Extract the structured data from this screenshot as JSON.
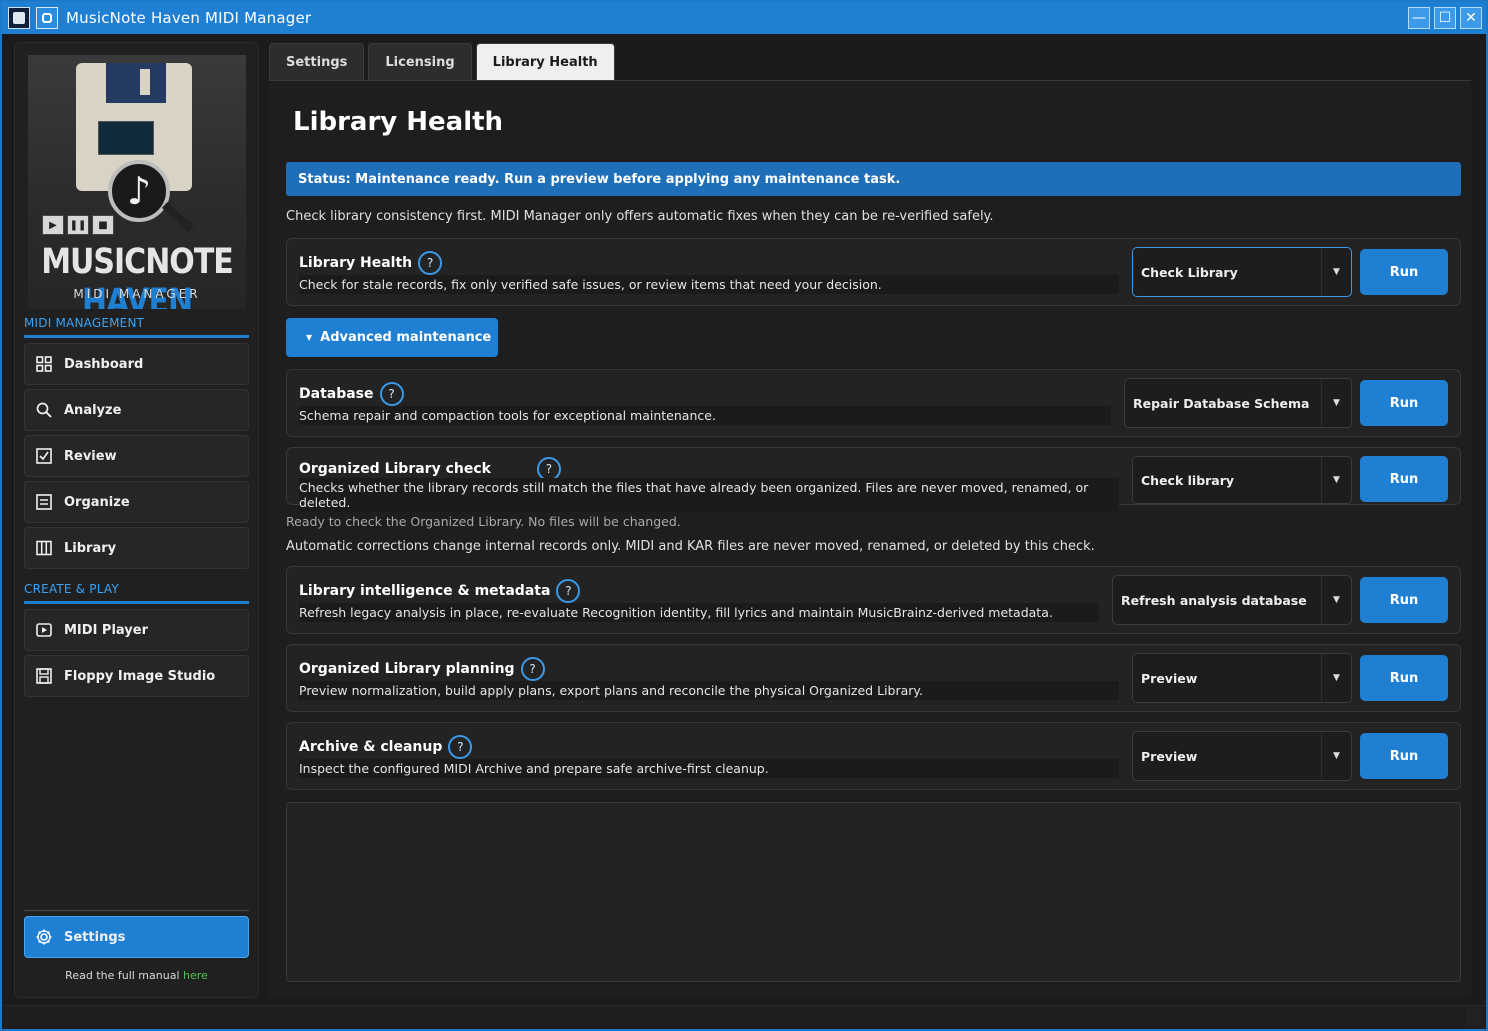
{
  "window": {
    "title": "MusicNote Haven MIDI Manager",
    "minimize_glyph": "—",
    "maximize_glyph": "☐",
    "close_glyph": "✕"
  },
  "logo": {
    "brand_part1": "MUSICNOTE ",
    "brand_part2": "HAVEN",
    "subtitle": "MIDI MANAGER",
    "note_glyph": "♪"
  },
  "sidebar": {
    "section1": "MIDI MANAGEMENT",
    "section2": "CREATE & PLAY",
    "items": [
      {
        "label": "Dashboard",
        "icon": "dashboard-icon"
      },
      {
        "label": "Analyze",
        "icon": "search-icon"
      },
      {
        "label": "Review",
        "icon": "checkbox-icon"
      },
      {
        "label": "Organize",
        "icon": "list-icon"
      },
      {
        "label": "Library",
        "icon": "columns-icon"
      }
    ],
    "create_items": [
      {
        "label": "MIDI Player",
        "icon": "play-icon"
      },
      {
        "label": "Floppy Image Studio",
        "icon": "floppy-icon"
      }
    ],
    "settings_label": "Settings",
    "manual_text": "Read the full manual ",
    "manual_link": "here"
  },
  "tabs": [
    {
      "label": "Settings"
    },
    {
      "label": "Licensing"
    },
    {
      "label": "Library Health"
    }
  ],
  "main": {
    "title": "Library Health",
    "status": "Status: Maintenance ready. Run a preview before applying any maintenance task.",
    "intro": "Check library consistency first. MIDI Manager only offers automatic fixes when they can be re-verified safely.",
    "advanced_label": "Advanced maintenance",
    "organized_note": "Ready to check the Organized Library. No files will be changed.",
    "auto_note": "Automatic corrections change internal records only. MIDI and KAR files are never moved, renamed, or deleted by this check.",
    "run_label": "Run",
    "help_glyph": "?",
    "cards": [
      {
        "title": "Library Health",
        "desc": "Check for stale records, fix only verified safe issues, or review items that need your decision.",
        "combo": "Check Library"
      },
      {
        "title": "Database",
        "desc": "Schema repair and compaction tools for exceptional maintenance.",
        "combo": "Repair Database Schema"
      },
      {
        "title": "Organized Library check",
        "desc": "Checks whether the library records still match the files that have already been organized. Files are never moved, renamed, or deleted.",
        "combo": "Check library"
      },
      {
        "title": "Library intelligence & metadata",
        "desc": "Refresh legacy analysis in place, re-evaluate Recognition identity, fill lyrics and maintain MusicBrainz-derived metadata.",
        "combo": "Refresh analysis database"
      },
      {
        "title": "Organized Library planning",
        "desc": "Preview normalization, build apply plans, export plans and reconcile the physical Organized Library.",
        "combo": "Preview"
      },
      {
        "title": "Archive & cleanup",
        "desc": "Inspect the configured MIDI Archive and prepare safe archive-first cleanup.",
        "combo": "Preview"
      }
    ]
  },
  "colors": {
    "accent": "#1f7fd3",
    "link": "#4cc44c",
    "background": "#1e1e1e"
  }
}
